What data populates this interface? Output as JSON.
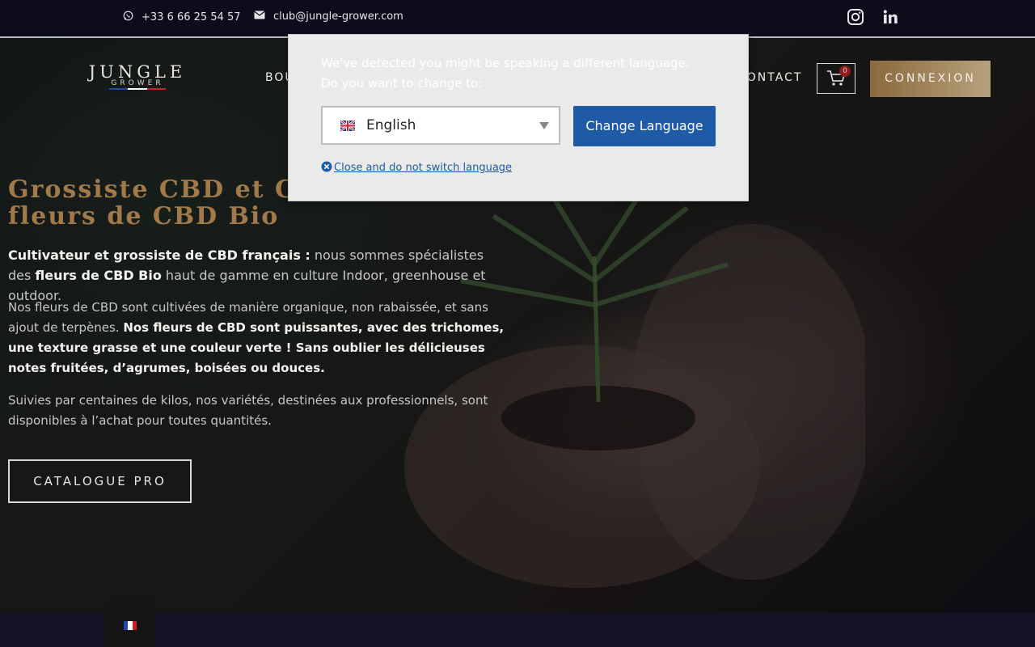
{
  "topbar": {
    "phone": "+33 6 66 25 54 57",
    "email": "club@jungle-grower.com",
    "icons": [
      "whatsapp-icon",
      "envelope-icon",
      "instagram-icon",
      "linkedin-icon"
    ]
  },
  "logo": {
    "name": "JUNGLE",
    "sub": "GROWER"
  },
  "nav": {
    "item_partial": "BOU",
    "contact": "CONTACT"
  },
  "cart": {
    "count": "0"
  },
  "connexion": "CONNEXION",
  "hero": {
    "headline_line1": "Grossiste CBD et Cu",
    "headline_line2": "fleurs de CBD Bio",
    "p1_bold1": "Cultivateur et grossiste de CBD français :",
    "p1_text1": " nous sommes spécialistes des ",
    "p1_bold2": "fleurs de CBD Bio",
    "p1_text2": " haut de gamme en culture Indoor, greenhouse et outdoor.",
    "p2_text": "Nos fleurs de CBD sont cultivées de manière organique, non rabaissée, et sans ajout de terpènes. ",
    "p2_bold": "Nos fleurs de CBD sont puissantes, avec des trichomes, une texture grasse et une couleur verte ! Sans oublier les délicieuses notes fruitées, d’agrumes, boisées ou douces.",
    "p3": "Suivies par centaines de kilos, nos variétés, destinées aux professionnels, sont disponibles à l’achat pour toutes quantités.",
    "cta": "CATALOGUE PRO"
  },
  "popup": {
    "message": "We've detected you might be speaking a different language. Do you want to change to:",
    "selected_language": "English",
    "change_button": "Change Language",
    "close_link": "Close and do not switch language"
  },
  "colors": {
    "accent_gold": "#a27a4a",
    "button_blue": "#1f5aa6",
    "dark_bg": "#0d0c1b"
  }
}
